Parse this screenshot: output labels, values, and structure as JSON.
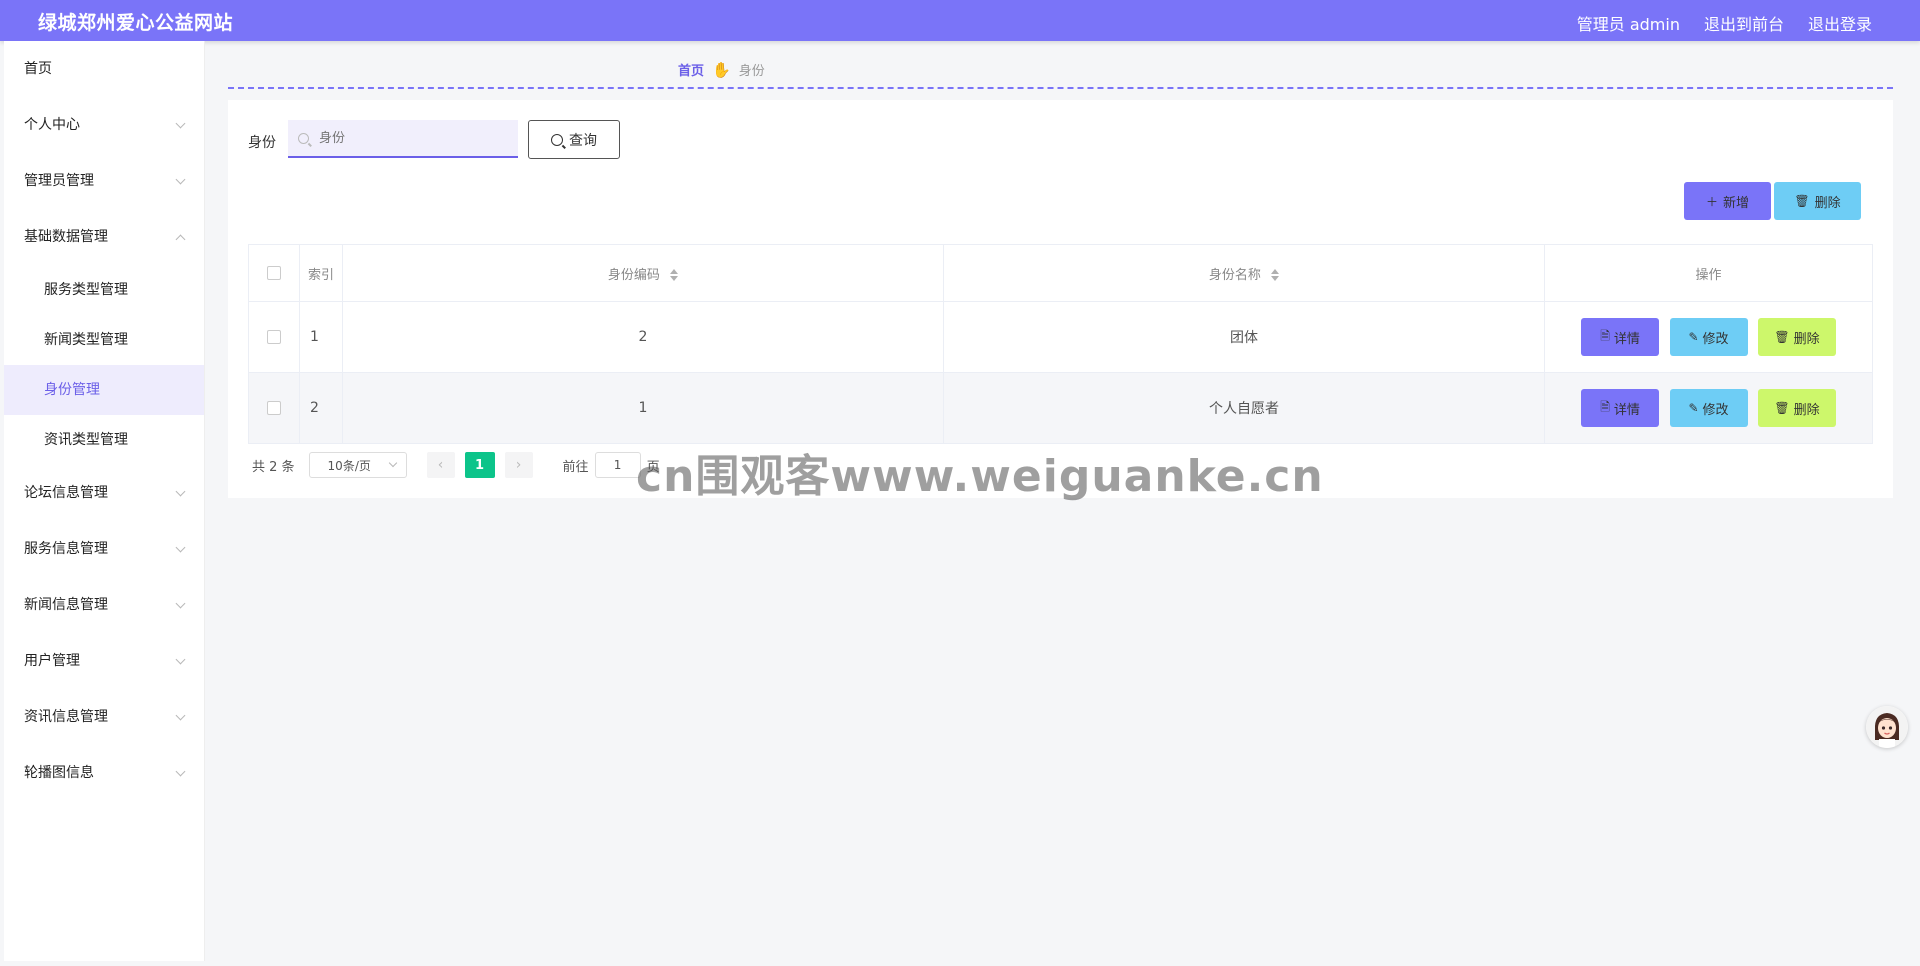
{
  "app": {
    "title": "绿城郑州爱心公益网站"
  },
  "header": {
    "user_label": "管理员 admin",
    "front_link": "退出到前台",
    "logout_link": "退出登录"
  },
  "sidebar": {
    "items": [
      {
        "label": "首页"
      },
      {
        "label": "个人中心"
      },
      {
        "label": "管理员管理"
      },
      {
        "label": "基础数据管理"
      },
      {
        "label": "服务类型管理"
      },
      {
        "label": "新闻类型管理"
      },
      {
        "label": "身份管理"
      },
      {
        "label": "资讯类型管理"
      },
      {
        "label": "论坛信息管理"
      },
      {
        "label": "服务信息管理"
      },
      {
        "label": "新闻信息管理"
      },
      {
        "label": "用户管理"
      },
      {
        "label": "资讯信息管理"
      },
      {
        "label": "轮播图信息"
      }
    ]
  },
  "breadcrumb": {
    "home": "首页",
    "hand_icon": "✋",
    "current": "身份"
  },
  "search": {
    "label": "身份",
    "placeholder": "身份",
    "query_label": "查询"
  },
  "actions": {
    "add_label": "新增",
    "delete_label": "删除"
  },
  "table": {
    "headers": {
      "index": "索引",
      "code": "身份编码",
      "name": "身份名称",
      "ops": "操作"
    },
    "rows": [
      {
        "index": "1",
        "code": "2",
        "name": "团体"
      },
      {
        "index": "2",
        "code": "1",
        "name": "个人自愿者"
      }
    ],
    "row_actions": {
      "detail": "详情",
      "edit": "修改",
      "delete": "删除"
    }
  },
  "pagination": {
    "total": "共 2 条",
    "page_size": "10条/页",
    "current_page": "1",
    "goto_label": "前往",
    "goto_value": "1",
    "goto_suffix": "页"
  },
  "watermark": "cn围观客www.weiguanke.cn",
  "colors": {
    "primary": "#7a74f8",
    "info": "#6ecdf5",
    "lime": "#cdf76b",
    "page_active": "#0cc48a"
  }
}
